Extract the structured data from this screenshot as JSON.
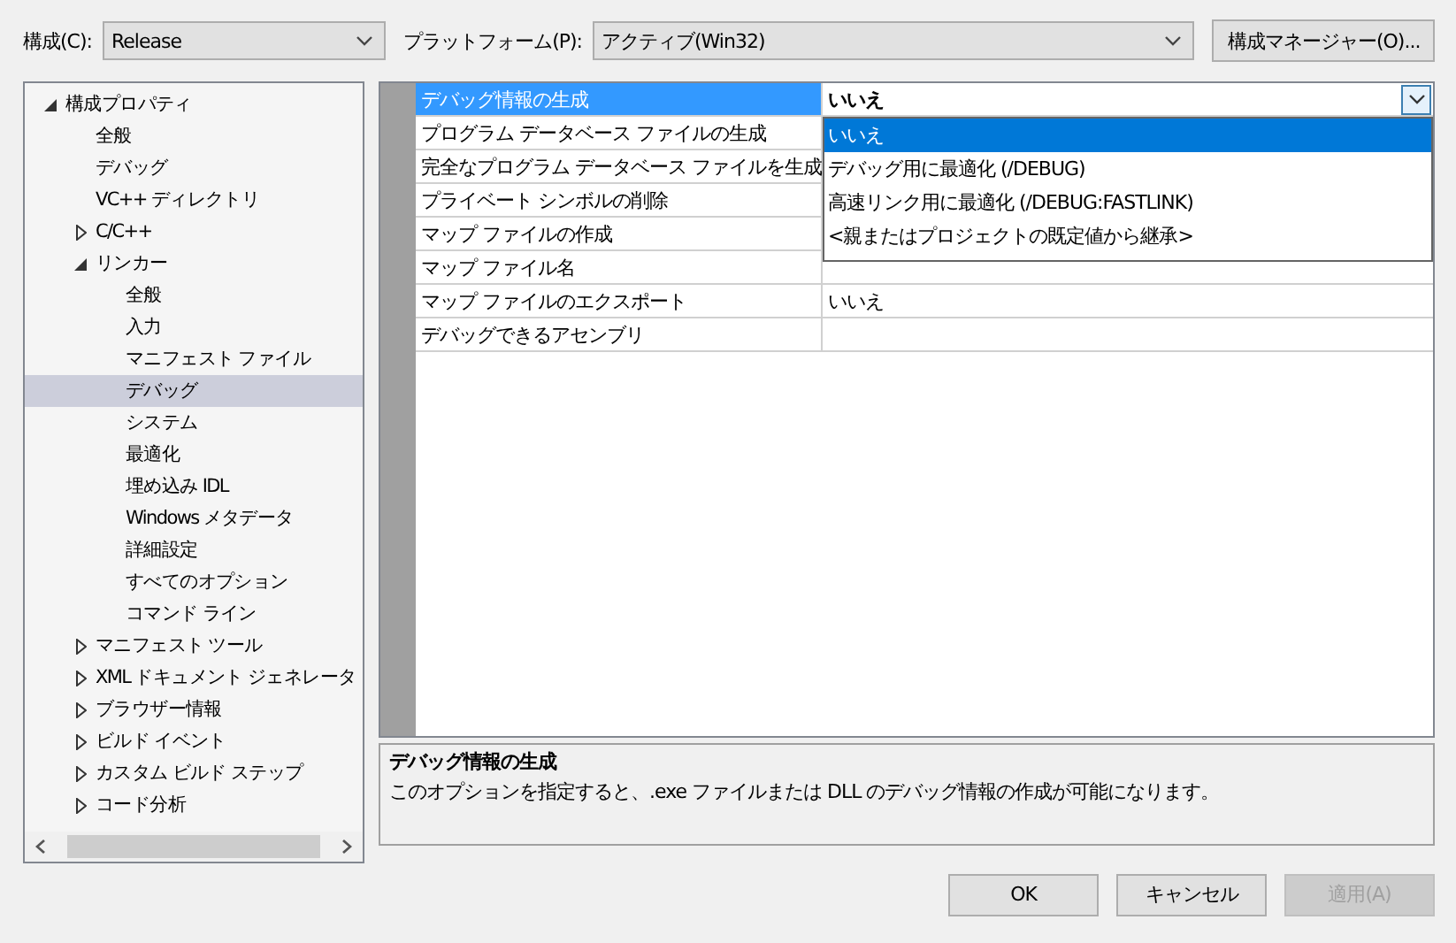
{
  "toolbar": {
    "config_label": "構成(C):",
    "config_value": "Release",
    "platform_label": "プラットフォーム(P):",
    "platform_value": "アクティブ(Win32)",
    "manager_button": "構成マネージャー(O)..."
  },
  "tree": [
    {
      "label": "構成プロパティ",
      "expanded": true,
      "selected": false,
      "children": [
        {
          "label": "全般",
          "selected": false
        },
        {
          "label": "デバッグ",
          "selected": false
        },
        {
          "label": "VC++ ディレクトリ",
          "selected": false
        },
        {
          "label": "C/C++",
          "expanded": false,
          "selected": false
        },
        {
          "label": "リンカー",
          "expanded": true,
          "selected": false,
          "children": [
            {
              "label": "全般",
              "selected": false
            },
            {
              "label": "入力",
              "selected": false
            },
            {
              "label": "マニフェスト ファイル",
              "selected": false
            },
            {
              "label": "デバッグ",
              "selected": true
            },
            {
              "label": "システム",
              "selected": false
            },
            {
              "label": "最適化",
              "selected": false
            },
            {
              "label": "埋め込み IDL",
              "selected": false
            },
            {
              "label": "Windows メタデータ",
              "selected": false
            },
            {
              "label": "詳細設定",
              "selected": false
            },
            {
              "label": "すべてのオプション",
              "selected": false
            },
            {
              "label": "コマンド ライン",
              "selected": false
            }
          ]
        },
        {
          "label": "マニフェスト ツール",
          "expanded": false,
          "selected": false
        },
        {
          "label": "XML ドキュメント ジェネレータ",
          "expanded": false,
          "selected": false
        },
        {
          "label": "ブラウザー情報",
          "expanded": false,
          "selected": false
        },
        {
          "label": "ビルド イベント",
          "expanded": false,
          "selected": false
        },
        {
          "label": "カスタム ビルド ステップ",
          "expanded": false,
          "selected": false
        },
        {
          "label": "コード分析",
          "expanded": false,
          "selected": false
        }
      ]
    }
  ],
  "grid": {
    "rows": [
      {
        "name": "デバッグ情報の生成",
        "value": "いいえ",
        "selected": true
      },
      {
        "name": "プログラム データベース ファイルの生成",
        "selected": false
      },
      {
        "name": "完全なプログラム データベース ファイルを生成",
        "selected": false
      },
      {
        "name": "プライベート シンボルの削除",
        "selected": false
      },
      {
        "name": "マップ ファイルの作成",
        "selected": false
      },
      {
        "name": "マップ ファイル名",
        "selected": false
      },
      {
        "name": "マップ ファイルのエクスポート",
        "value": "いいえ",
        "selected": false
      },
      {
        "name": "デバッグできるアセンブリ",
        "selected": false
      }
    ]
  },
  "dropdown": {
    "options": [
      {
        "label": "いいえ",
        "selected": true
      },
      {
        "label": "デバッグ用に最適化 (/DEBUG)",
        "selected": false
      },
      {
        "label": "高速リンク用に最適化 (/DEBUG:FASTLINK)",
        "selected": false
      },
      {
        "label": "<親またはプロジェクトの既定値から継承>",
        "selected": false
      }
    ]
  },
  "description": {
    "title": "デバッグ情報の生成",
    "text": "このオプションを指定すると、.exe ファイルまたは DLL のデバッグ情報の作成が可能になります。"
  },
  "buttons": [
    {
      "label": "OK",
      "disabled": false
    },
    {
      "label": "キャンセル",
      "disabled": false
    },
    {
      "label": "適用(A)",
      "disabled": true
    }
  ]
}
